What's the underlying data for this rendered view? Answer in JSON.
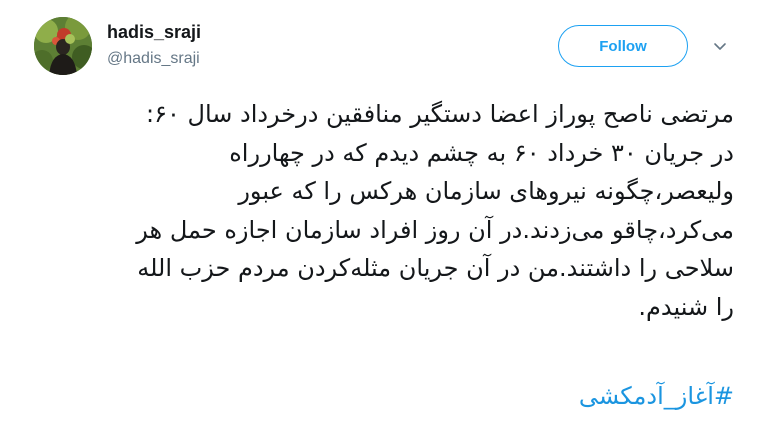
{
  "author": {
    "display_name": "hadis_sraji",
    "handle": "@hadis_sraji",
    "avatar_icon": "profile-photo-icon"
  },
  "actions": {
    "follow_label": "Follow",
    "more_icon": "chevron-down-icon"
  },
  "tweet": {
    "lines": [
      "مرتضی ناصح پوراز اعضا دستگیر منافقین درخرداد سال ۶۰:",
      "در جریان ۳۰ خرداد ۶۰ به چشم دیدم که در چهارراه",
      "ولیعصر،چگونه نیروهای سازمان هرکس را که عبور",
      "می‌کرد،چاقو می‌زدند.در آن روز افراد سازمان اجازه حمل هر",
      "سلاحی را داشتند.من در آن جریان مثله‌کردن مردم حزب الله",
      "را شنیدم."
    ],
    "hashtag": "#آغاز_آدمکشی"
  },
  "colors": {
    "accent": "#1da1f2",
    "hashtag": "#1b95e0",
    "text": "#14171a",
    "secondary": "#657786"
  }
}
